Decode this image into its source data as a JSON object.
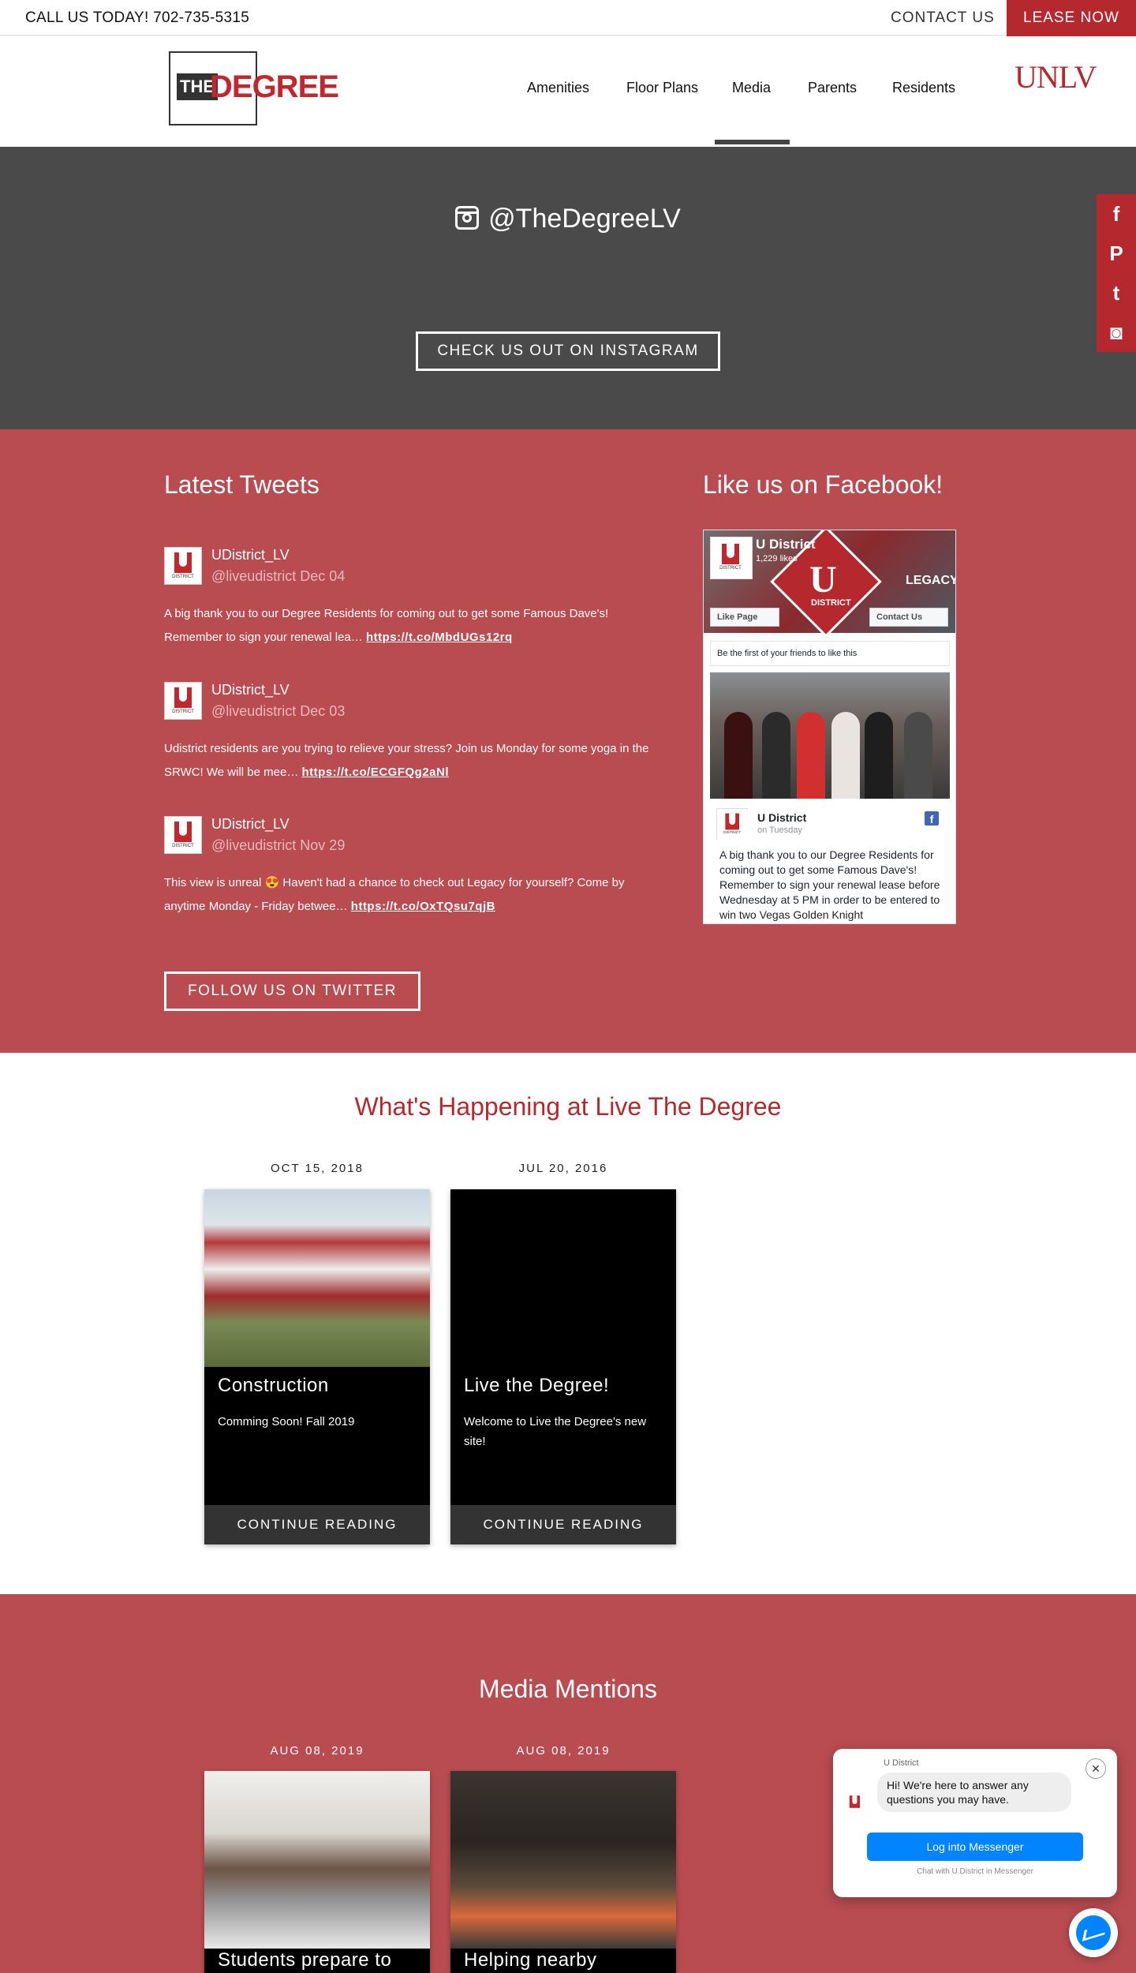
{
  "topbar": {
    "phone": "CALL US TODAY! 702-735-5315",
    "contact": "CONTACT US",
    "lease": "LEASE NOW"
  },
  "header": {
    "logo_the": "THE",
    "logo_degree": "DEGREE",
    "nav": [
      "Amenities",
      "Floor Plans",
      "Media",
      "Parents",
      "Residents"
    ],
    "active_nav": "Media",
    "partner": "UNLV"
  },
  "instagram": {
    "handle": "@TheDegreeLV",
    "button": "CHECK US OUT ON INSTAGRAM"
  },
  "social": {
    "icons": [
      "facebook-icon",
      "pinterest-icon",
      "twitter-icon",
      "instagram-icon"
    ],
    "glyphs": [
      "f",
      "P",
      "t",
      "◙"
    ]
  },
  "tweets": {
    "title": "Latest Tweets",
    "items": [
      {
        "name": "UDistrict_LV",
        "handle": "@liveudistrict Dec 04",
        "text": "A big thank you to our Degree Residents for coming out to get some Famous Dave's! Remember to sign your renewal lea…",
        "link": "https://t.co/MbdUGs12rq"
      },
      {
        "name": "UDistrict_LV",
        "handle": "@liveudistrict Dec 03",
        "text": "Udistrict residents are you trying to relieve your stress? Join us Monday for some yoga in the SRWC! We will be mee…",
        "link": "https://t.co/ECGFQg2aNl"
      },
      {
        "name": "UDistrict_LV",
        "handle": "@liveudistrict Nov 29",
        "text": "This view is unreal 😍 Haven't had a chance to check out Legacy for yourself? Come by anytime Monday - Friday betwee…",
        "link": "https://t.co/OxTQsu7qjB"
      }
    ],
    "follow_button": "FOLLOW US ON TWITTER"
  },
  "facebook": {
    "title": "Like us on Facebook!",
    "page_name": "U District",
    "likes": "1,229 likes",
    "like_button": "Like Page",
    "contact_button": "Contact Us",
    "friends_text": "Be the first of your friends to like this",
    "cover_brand": "U",
    "cover_sub": "DISTRICT",
    "cover_legacy": "LEGACY",
    "post_name": "U District",
    "post_time": "on Tuesday",
    "post_text": "A big thank you to our Degree Residents for coming out to get some Famous Dave's! Remember to sign your renewal lease before Wednesday at 5 PM in order to be entered to win two Vegas Golden Knight"
  },
  "happening": {
    "title": "What's Happening at Live The Degree",
    "cards": [
      {
        "date": "OCT 15, 2018",
        "title": "Construction",
        "desc": "Comming Soon! Fall 2019",
        "button": "CONTINUE READING"
      },
      {
        "date": "JUL 20, 2016",
        "title": "Live the Degree!",
        "desc": "Welcome to Live the Degree's new site!",
        "button": "CONTINUE READING"
      }
    ]
  },
  "media": {
    "title": "Media Mentions",
    "cards": [
      {
        "date": "AUG 08, 2019",
        "title": "Students prepare to"
      },
      {
        "date": "AUG 08, 2019",
        "title": "Helping nearby"
      }
    ]
  },
  "messenger": {
    "from": "U District",
    "greeting": "Hi! We're here to answer any questions you may have.",
    "login": "Log into Messenger",
    "footer": "Chat with U District in Messenger",
    "close": "✕"
  },
  "avatar_label": "DISTRICT",
  "colors": {
    "brand_red": "#b5292e",
    "band_red": "#b94c51",
    "dark_gray": "#4a4a4a",
    "messenger_blue": "#0084ff"
  }
}
